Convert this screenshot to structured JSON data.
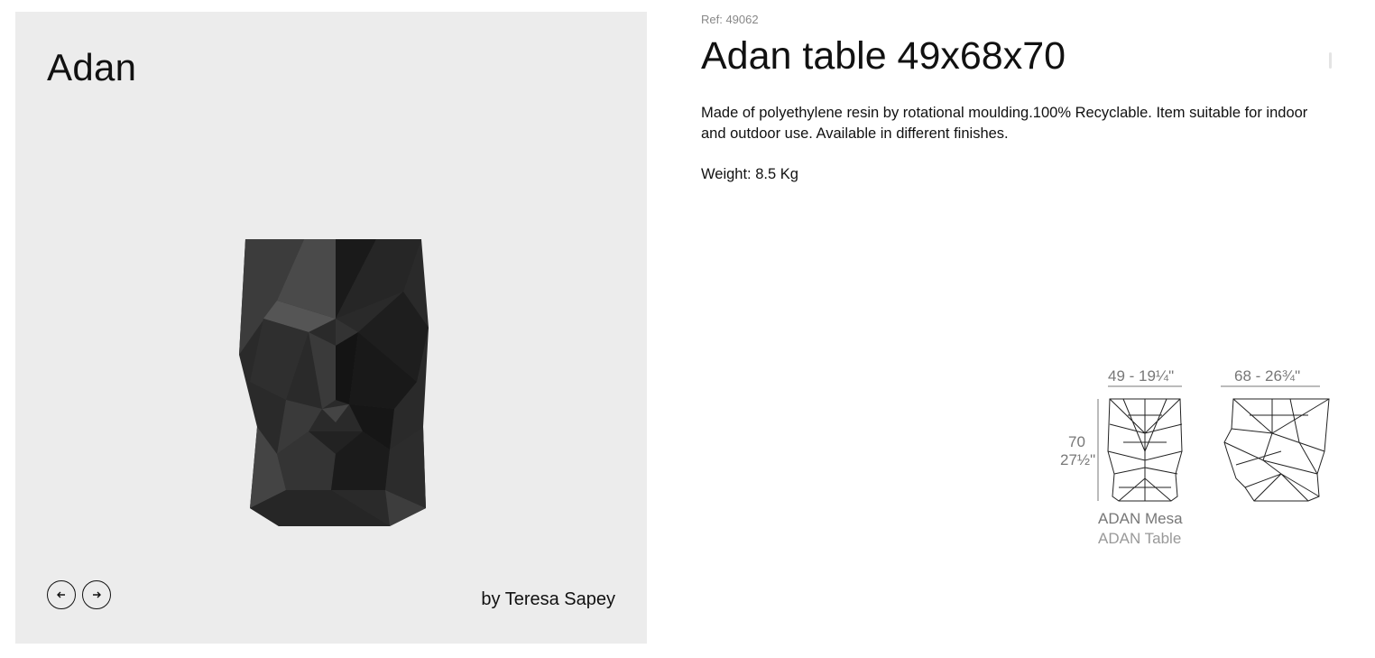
{
  "gallery": {
    "collection_title": "Adan",
    "designer": "by Teresa Sapey",
    "prev_icon": "arrow-left-icon",
    "next_icon": "arrow-right-icon"
  },
  "product": {
    "ref": "Ref: 49062",
    "title": "Adan table 49x68x70",
    "description": "Made of polyethylene resin by rotational moulding.100% Recyclable. Item suitable for indoor and outdoor use. Available in different finishes.",
    "weight": "Weight: 8.5 Kg"
  },
  "drawing": {
    "width_label": "49 - 19¼\"",
    "depth_label": "68 - 26¾\"",
    "height_cm": "70",
    "height_in": "27½\"",
    "caption_es": "ADAN Mesa",
    "caption_en": "ADAN Table"
  },
  "colors": {
    "panel_bg": "#ececec",
    "text": "#111111",
    "muted": "#888888"
  }
}
